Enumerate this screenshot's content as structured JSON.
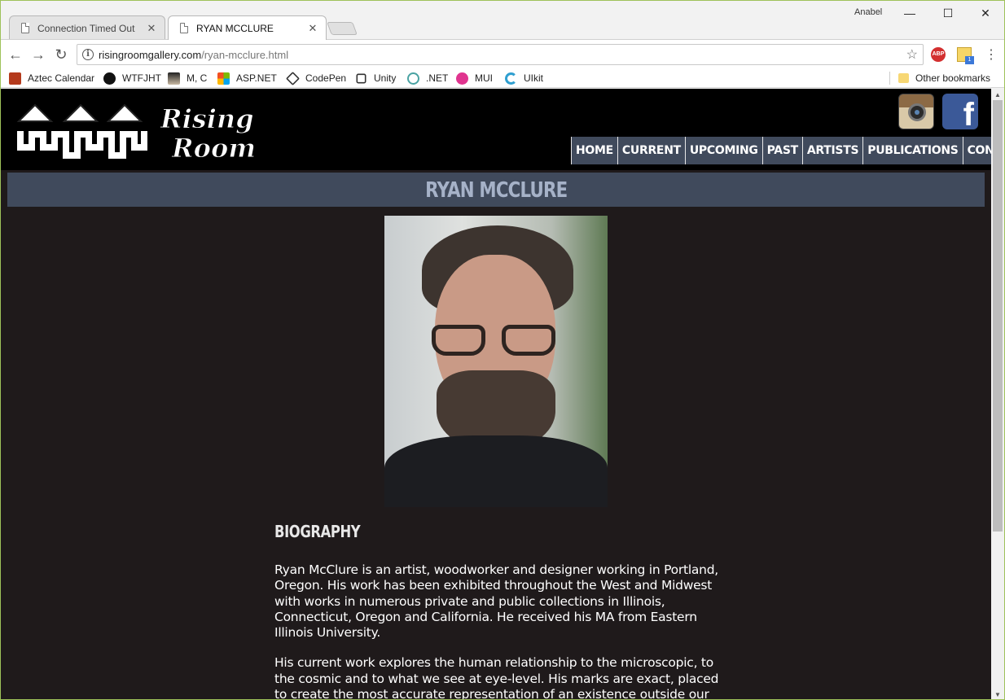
{
  "browser": {
    "tabs": [
      {
        "label": "Connection Timed Out",
        "active": false
      },
      {
        "label": "RYAN MCCLURE",
        "active": true
      }
    ],
    "profile_name": "Anabel",
    "url": {
      "host": "risingroomgallery.com",
      "path": "/ryan-mcclure.html"
    },
    "extensions": {
      "adblock": "ABP",
      "badge_count": "1"
    },
    "bookmarks": [
      {
        "label": "Aztec Calendar",
        "icon": "aztec-calendar-icon",
        "color": "#b43a1c"
      },
      {
        "label": "WTFJHT",
        "icon": "wtfjht-icon",
        "color": "#111111"
      },
      {
        "label": "M, C",
        "icon": "mc-icon",
        "color": "#6b5a4a"
      },
      {
        "label": "ASP.NET",
        "icon": "windows-logo-icon",
        "color": "#f25022"
      },
      {
        "label": "CodePen",
        "icon": "codepen-icon",
        "color": "#333333"
      },
      {
        "label": "Unity",
        "icon": "unity-icon",
        "color": "#333333"
      },
      {
        "label": ".NET",
        "icon": "dotnet-icon",
        "color": "#4aa3a3"
      },
      {
        "label": "MUI",
        "icon": "mui-icon",
        "color": "#e0348f"
      },
      {
        "label": "UIkit",
        "icon": "uikit-icon",
        "color": "#2f9fd0"
      }
    ],
    "other_bookmarks": "Other bookmarks"
  },
  "site": {
    "logo_text": "Rising Room",
    "social": {
      "instagram": "instagram-icon",
      "facebook": "f"
    },
    "nav": [
      "HOME",
      "CURRENT",
      "UPCOMING",
      "PAST",
      "ARTISTS",
      "PUBLICATIONS",
      "CONTACT"
    ],
    "colors": {
      "nav_bg": "#404a5c",
      "page_bg": "#1f1a1b",
      "title_text": "#a6b2c8"
    }
  },
  "page": {
    "title": "RYAN MCCLURE",
    "bio_heading": "BIOGRAPHY",
    "bio_paragraphs": [
      "Ryan McClure is an artist, woodworker and designer working in Portland, Oregon. His work has been exhibited throughout the West and Midwest with works in numerous private and public collections in Illinois, Connecticut, Oregon and California. He received his MA from Eastern Illinois University.",
      "His current work explores the human relationship to the microscopic, to the cosmic and to what we see at eye-level. His marks are exact, placed to create the most accurate representation of an existence outside our"
    ]
  }
}
